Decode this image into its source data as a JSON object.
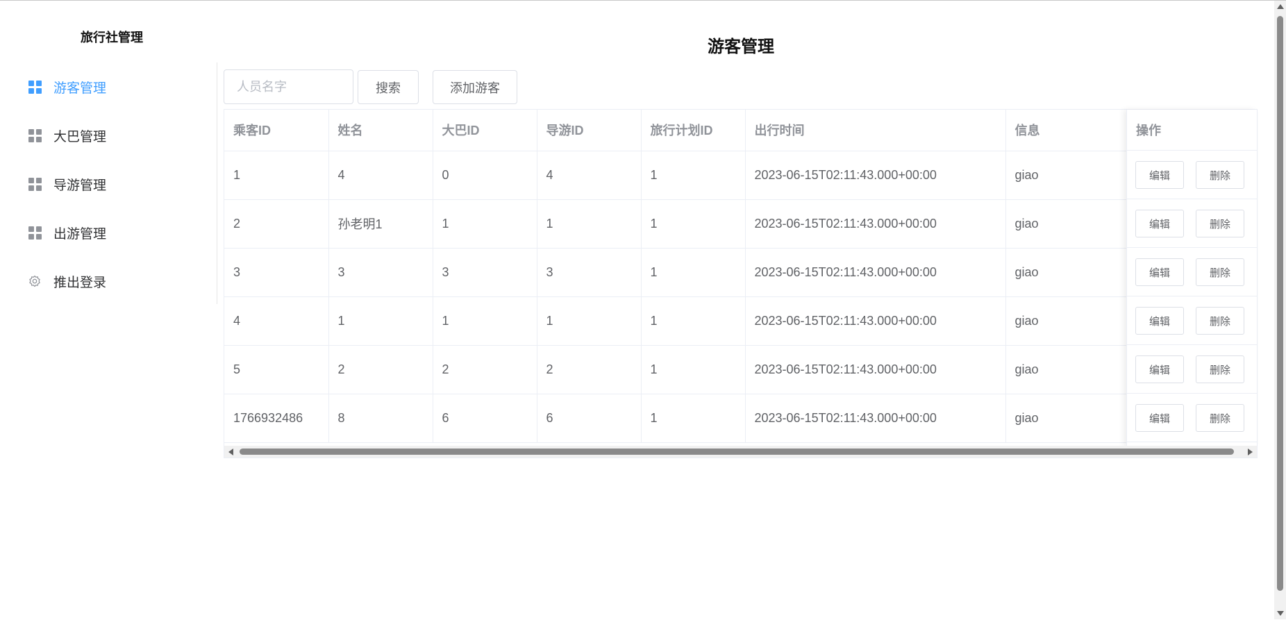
{
  "sidebar": {
    "brand": "旅行社管理",
    "items": [
      {
        "label": "游客管理",
        "icon": "grid-icon",
        "active": true
      },
      {
        "label": "大巴管理",
        "icon": "grid-icon",
        "active": false
      },
      {
        "label": "导游管理",
        "icon": "grid-icon",
        "active": false
      },
      {
        "label": "出游管理",
        "icon": "grid-icon",
        "active": false
      },
      {
        "label": "推出登录",
        "icon": "gear-icon",
        "active": false
      }
    ]
  },
  "main": {
    "title": "游客管理",
    "search": {
      "placeholder": "人员名字",
      "value": ""
    },
    "search_button": "搜索",
    "add_button": "添加游客"
  },
  "table": {
    "columns": [
      "乘客ID",
      "姓名",
      "大巴ID",
      "导游ID",
      "旅行计划ID",
      "出行时间",
      "信息",
      "操作"
    ],
    "rows": [
      [
        "1",
        "4",
        "0",
        "4",
        "1",
        "2023-06-15T02:11:43.000+00:00",
        "giao"
      ],
      [
        "2",
        "孙老明1",
        "1",
        "1",
        "1",
        "2023-06-15T02:11:43.000+00:00",
        "giao"
      ],
      [
        "3",
        "3",
        "3",
        "3",
        "1",
        "2023-06-15T02:11:43.000+00:00",
        "giao"
      ],
      [
        "4",
        "1",
        "1",
        "1",
        "1",
        "2023-06-15T02:11:43.000+00:00",
        "giao"
      ],
      [
        "5",
        "2",
        "2",
        "2",
        "1",
        "2023-06-15T02:11:43.000+00:00",
        "giao"
      ],
      [
        "1766932486",
        "8",
        "6",
        "6",
        "1",
        "2023-06-15T02:11:43.000+00:00",
        "giao"
      ]
    ],
    "edit_label": "编辑",
    "delete_label": "删除"
  },
  "colors": {
    "accent": "#409eff",
    "header_text": "#909399",
    "body_text": "#606266"
  }
}
